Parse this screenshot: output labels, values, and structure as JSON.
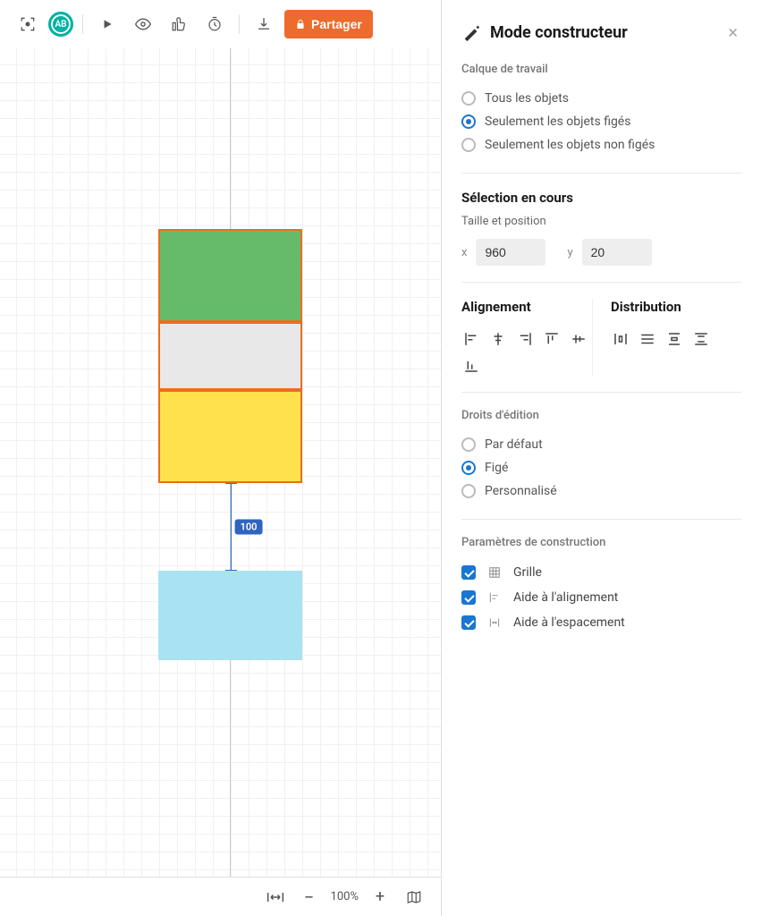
{
  "toolbar": {
    "avatar_initials": "AB",
    "share_label": "Partager"
  },
  "canvas": {
    "dimension_label": "100",
    "zoom_label": "100%"
  },
  "panel": {
    "title": "Mode constructeur",
    "working_layer": {
      "label": "Calque de travail",
      "options": {
        "all": "Tous les objets",
        "fixed": "Seulement les objets figés",
        "unfixed": "Seulement les objets non figés"
      },
      "selected": "fixed"
    },
    "selection": {
      "label": "Sélection en cours",
      "size_pos_label": "Taille et position",
      "x_label": "x",
      "y_label": "y",
      "x_value": "960",
      "y_value": "20"
    },
    "alignment": {
      "align_label": "Alignement",
      "dist_label": "Distribution"
    },
    "edit_rights": {
      "label": "Droits d'édition",
      "options": {
        "default": "Par défaut",
        "fixed": "Figé",
        "custom": "Personnalisé"
      },
      "selected": "fixed"
    },
    "build_params": {
      "label": "Paramètres de construction",
      "grid": "Grille",
      "align_help": "Aide à l'alignement",
      "space_help": "Aide à l'espacement"
    }
  }
}
